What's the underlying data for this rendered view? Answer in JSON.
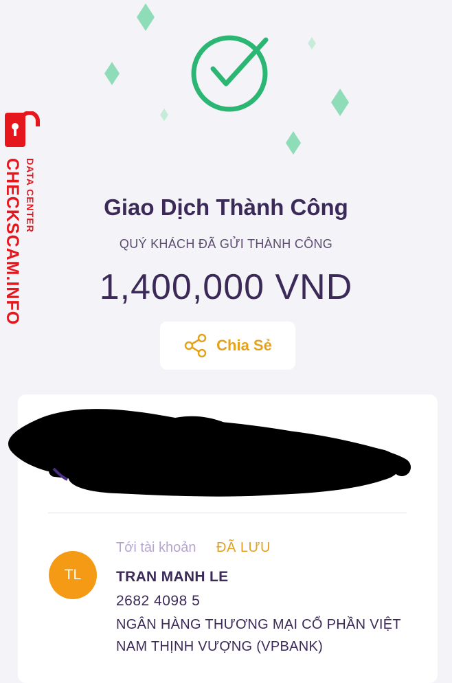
{
  "header": {
    "success_icon": "check-circle-icon",
    "decoration_icon": "sparkle-icon",
    "accent_color": "#2bb673",
    "sparkle_color": "#8fdcb8"
  },
  "watermark": {
    "brand": "CHECKSCAM.INFO",
    "tagline": "DATA CENTER",
    "icon": "lock-icon",
    "color": "#e5171d"
  },
  "transaction": {
    "title": "Giao Dịch Thành Công",
    "subtitle": "QUÝ KHÁCH ĐÃ GỬI THÀNH CÔNG",
    "amount": "1,400,000 VND"
  },
  "share": {
    "label": "Chia Sẻ",
    "icon": "share-icon",
    "color": "#e4a11b"
  },
  "recipient": {
    "to_account_label": "Tới tài khoản",
    "saved_badge": "ĐÃ LƯU",
    "avatar_initials": "TL",
    "avatar_color": "#f59a14",
    "name": "TRAN MANH LE",
    "account_number": "2682 4098 5",
    "bank_line_1": "NGÂN HÀNG THƯƠNG MẠI CỔ PHẦN VIỆT",
    "bank_line_2": "NAM THỊNH VƯỢNG (VPBANK)"
  }
}
